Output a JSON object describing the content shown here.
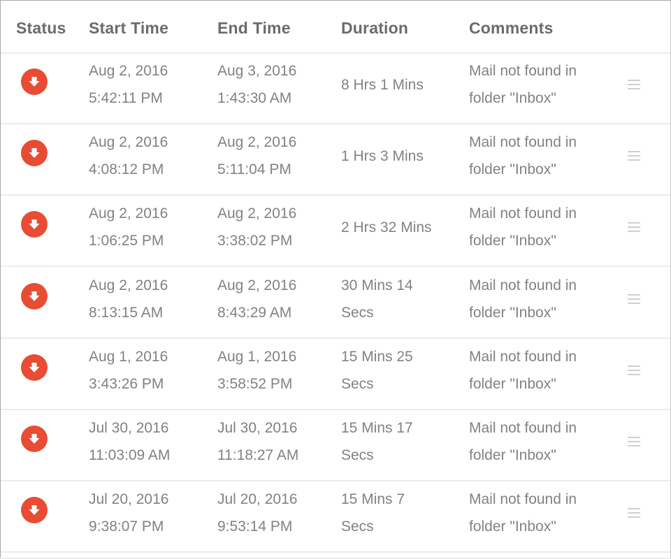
{
  "table": {
    "headers": {
      "status": "Status",
      "start_time": "Start Time",
      "end_time": "End Time",
      "duration": "Duration",
      "comments": "Comments"
    },
    "status_icon": "down-arrow-circle-icon",
    "status_color": "#e84c34",
    "row_menu_icon": "hamburger-menu-icon",
    "rows": [
      {
        "status": "down",
        "start_date": "Aug 2, 2016",
        "start_time": "5:42:11 PM",
        "end_date": "Aug 3, 2016",
        "end_time": "1:43:30 AM",
        "duration": "8 Hrs 1 Mins",
        "comment_line1": "Mail not found in",
        "comment_line2": "folder \"Inbox\""
      },
      {
        "status": "down",
        "start_date": "Aug 2, 2016",
        "start_time": "4:08:12 PM",
        "end_date": "Aug 2, 2016",
        "end_time": "5:11:04 PM",
        "duration": "1 Hrs 3 Mins",
        "comment_line1": "Mail not found in",
        "comment_line2": "folder \"Inbox\""
      },
      {
        "status": "down",
        "start_date": "Aug 2, 2016",
        "start_time": "1:06:25 PM",
        "end_date": "Aug 2, 2016",
        "end_time": "3:38:02 PM",
        "duration": "2 Hrs 32 Mins",
        "comment_line1": "Mail not found in",
        "comment_line2": "folder \"Inbox\""
      },
      {
        "status": "down",
        "start_date": "Aug 2, 2016",
        "start_time": "8:13:15 AM",
        "end_date": "Aug 2, 2016",
        "end_time": "8:43:29 AM",
        "duration": "30 Mins 14 Secs",
        "comment_line1": "Mail not found in",
        "comment_line2": "folder \"Inbox\""
      },
      {
        "status": "down",
        "start_date": "Aug 1, 2016",
        "start_time": "3:43:26 PM",
        "end_date": "Aug 1, 2016",
        "end_time": "3:58:52 PM",
        "duration": "15 Mins 25 Secs",
        "comment_line1": "Mail not found in",
        "comment_line2": "folder \"Inbox\""
      },
      {
        "status": "down",
        "start_date": "Jul 30, 2016",
        "start_time": "11:03:09 AM",
        "end_date": "Jul 30, 2016",
        "end_time": "11:18:27 AM",
        "duration": "15 Mins 17 Secs",
        "comment_line1": "Mail not found in",
        "comment_line2": "folder \"Inbox\""
      },
      {
        "status": "down",
        "start_date": "Jul 20, 2016",
        "start_time": "9:38:07 PM",
        "end_date": "Jul 20, 2016",
        "end_time": "9:53:14 PM",
        "duration": "15 Mins 7 Secs",
        "comment_line1": "Mail not found in",
        "comment_line2": "folder \"Inbox\""
      }
    ]
  }
}
